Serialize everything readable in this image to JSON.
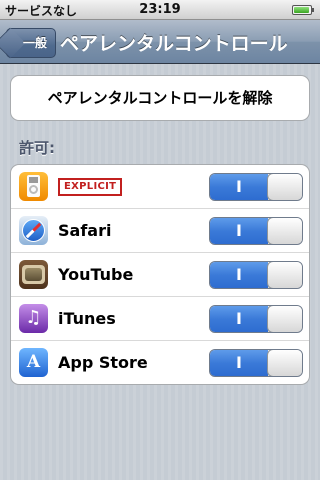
{
  "status_bar": {
    "carrier": "サービスなし",
    "time": "23:19"
  },
  "nav_bar": {
    "back_label": "一般",
    "title": "ペアレンタルコントロール"
  },
  "unlock_button": {
    "label": "ペアレンタルコントロールを解除"
  },
  "allow_section": {
    "header": "許可:",
    "items": [
      {
        "icon": "ipod-icon",
        "badge": "EXPLICIT",
        "toggle_label": "I",
        "enabled": true
      },
      {
        "icon": "safari-icon",
        "label": "Safari",
        "toggle_label": "I",
        "enabled": true
      },
      {
        "icon": "youtube-icon",
        "label": "YouTube",
        "toggle_label": "I",
        "enabled": true
      },
      {
        "icon": "itunes-icon",
        "label": "iTunes",
        "toggle_label": "I",
        "enabled": true
      },
      {
        "icon": "app-store-icon",
        "label": "App Store",
        "toggle_label": "I",
        "enabled": true
      }
    ]
  },
  "colors": {
    "toggle_on": "#3b7ad8",
    "explicit_red": "#c2201f",
    "section_header": "#4c566c"
  }
}
